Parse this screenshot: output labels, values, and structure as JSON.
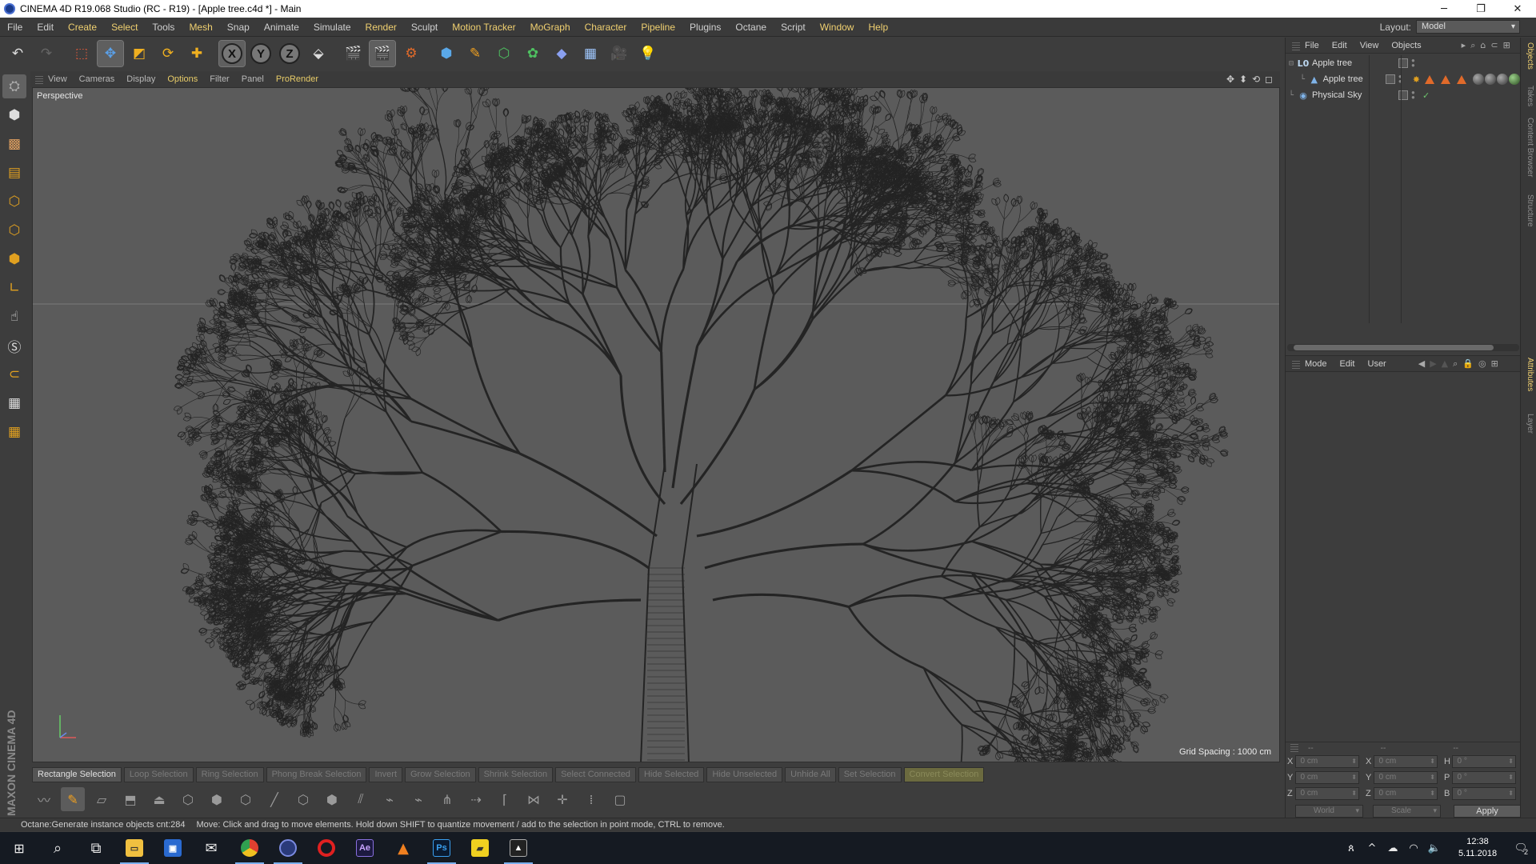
{
  "window": {
    "title": "CINEMA 4D R19.068 Studio (RC - R19) - [Apple tree.c4d *] - Main",
    "minimize": "─",
    "maximize": "❐",
    "close": "✕"
  },
  "menu": {
    "items": [
      "File",
      "Edit",
      "Create",
      "Select",
      "Tools",
      "Mesh",
      "Snap",
      "Animate",
      "Simulate",
      "Render",
      "Sculpt",
      "Motion Tracker",
      "MoGraph",
      "Character",
      "Pipeline",
      "Plugins",
      "Octane",
      "Script",
      "Window",
      "Help"
    ],
    "highlighted": [
      "Create",
      "Select",
      "Mesh",
      "Render",
      "Motion Tracker",
      "MoGraph",
      "Character",
      "Pipeline",
      "Window",
      "Help"
    ],
    "layout_label": "Layout:",
    "layout_value": "Model"
  },
  "toolbar": {
    "undo": "↶",
    "redo": "↷",
    "axis_x": "X",
    "axis_y": "Y",
    "axis_z": "Z"
  },
  "viewport": {
    "menu": [
      "View",
      "Cameras",
      "Display",
      "Options",
      "Filter",
      "Panel",
      "ProRender"
    ],
    "highlighted_menu": [
      "Options",
      "ProRender"
    ],
    "label": "Perspective",
    "grid_spacing": "Grid Spacing : 1000 cm",
    "nav_icons": [
      "✥",
      "⬍",
      "⟲",
      "◻"
    ],
    "background_color": "#5b5b5b",
    "wire_color": "#242424"
  },
  "selection_bar": {
    "buttons": [
      "Rectangle Selection",
      "Loop Selection",
      "Ring Selection",
      "Phong Break Selection",
      "Invert",
      "Grow Selection",
      "Shrink Selection",
      "Select Connected",
      "Hide Selected",
      "Hide Unselected",
      "Unhide All",
      "Set Selection",
      "Convert Selection"
    ]
  },
  "status": {
    "left": "Octane:Generate instance objects cnt:284",
    "message": "Move: Click and drag to move elements. Hold down SHIFT to quantize movement / add to the selection in point mode, CTRL to remove."
  },
  "object_manager": {
    "menu": [
      "File",
      "Edit",
      "View",
      "Objects"
    ],
    "objects": [
      {
        "name": "Apple tree",
        "icon": "null-object-icon"
      },
      {
        "name": "Apple tree",
        "icon": "tree-object-icon"
      },
      {
        "name": "Physical Sky",
        "icon": "sky-icon"
      }
    ]
  },
  "attribute_manager": {
    "menu": [
      "Mode",
      "Edit",
      "User"
    ]
  },
  "coordinates": {
    "headers": [
      "--",
      "--",
      "--"
    ],
    "rows": [
      {
        "l1": "X",
        "v1": "0 cm",
        "l2": "X",
        "v2": "0 cm",
        "l3": "H",
        "v3": "0 °"
      },
      {
        "l1": "Y",
        "v1": "0 cm",
        "l2": "Y",
        "v2": "0 cm",
        "l3": "P",
        "v3": "0 °"
      },
      {
        "l1": "Z",
        "v1": "0 cm",
        "l2": "Z",
        "v2": "0 cm",
        "l3": "B",
        "v3": "0 °"
      }
    ],
    "space": "World",
    "mode": "Scale",
    "apply": "Apply"
  },
  "side_tabs": [
    "Objects",
    "Takes",
    "Content Browser",
    "Structure",
    "Attributes",
    "Layer"
  ],
  "maxon": "MAXON CINEMA 4D",
  "taskbar": {
    "time": "12:38",
    "date": "5.11.2018",
    "notification_count": "2"
  }
}
